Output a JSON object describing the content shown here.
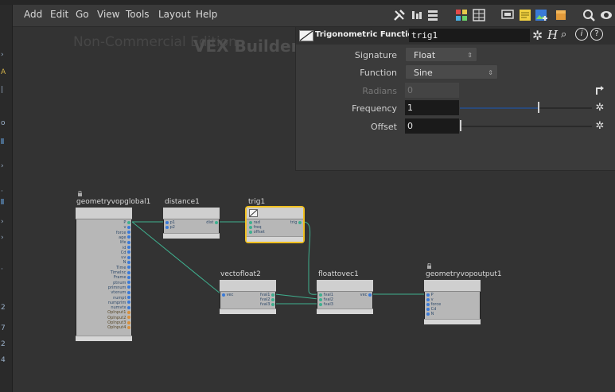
{
  "menu": {
    "items": [
      "Add",
      "Edit",
      "Go",
      "View",
      "Tools",
      "Layout",
      "Help"
    ]
  },
  "toolbar": {
    "icons": [
      "wrench-icon",
      "align-icon",
      "list-icon",
      "grid-color-icon",
      "grid-icon",
      "display-icon",
      "note-icon",
      "image-icon",
      "box-icon",
      "search-icon",
      "eye-icon"
    ]
  },
  "canvas": {
    "watermark": "Non-Commercial Edition",
    "network_title": "VEX Builder"
  },
  "param_panel": {
    "node_type": "Trigonometric Functions",
    "node_name": "trig1",
    "params": {
      "signature": {
        "label": "Signature",
        "value": "Float"
      },
      "function": {
        "label": "Function",
        "value": "Sine"
      },
      "radians": {
        "label": "Radians",
        "value": "0"
      },
      "frequency": {
        "label": "Frequency",
        "value": "1"
      },
      "offset": {
        "label": "Offset",
        "value": "0"
      }
    }
  },
  "nodes": {
    "global": {
      "name": "geometryvopglobal1",
      "outputs": [
        "P",
        "v",
        "force",
        "age",
        "life",
        "id",
        "Cd",
        "uv",
        "N",
        "Time",
        "TimeInc",
        "Frame",
        "ptnum",
        "primnum",
        "vtxnum",
        "numpt",
        "numprim",
        "numvtx",
        "OpInput1",
        "OpInput2",
        "OpInput3",
        "OpInput4"
      ]
    },
    "distance": {
      "name": "distance1",
      "inputs": [
        "p1",
        "p2"
      ],
      "outputs": [
        "dist"
      ]
    },
    "trig": {
      "name": "trig1",
      "inputs": [
        "rad",
        "freq",
        "offset"
      ],
      "outputs": [
        "trig"
      ]
    },
    "vectofloat": {
      "name": "vectofloat2",
      "inputs": [
        "vec"
      ],
      "outputs": [
        "fval1",
        "fval2",
        "fval3"
      ]
    },
    "floattovec": {
      "name": "floattovec1",
      "inputs": [
        "fval1",
        "fval2",
        "fval3"
      ],
      "outputs": [
        "vec"
      ]
    },
    "output": {
      "name": "geometryvopoutput1",
      "inputs": [
        "P",
        "v",
        "force",
        "Cd",
        "N"
      ]
    }
  },
  "colors": {
    "wire": "#3fb08f",
    "selected_node_border": "#f0c020",
    "canvas_bg": "#333333"
  }
}
